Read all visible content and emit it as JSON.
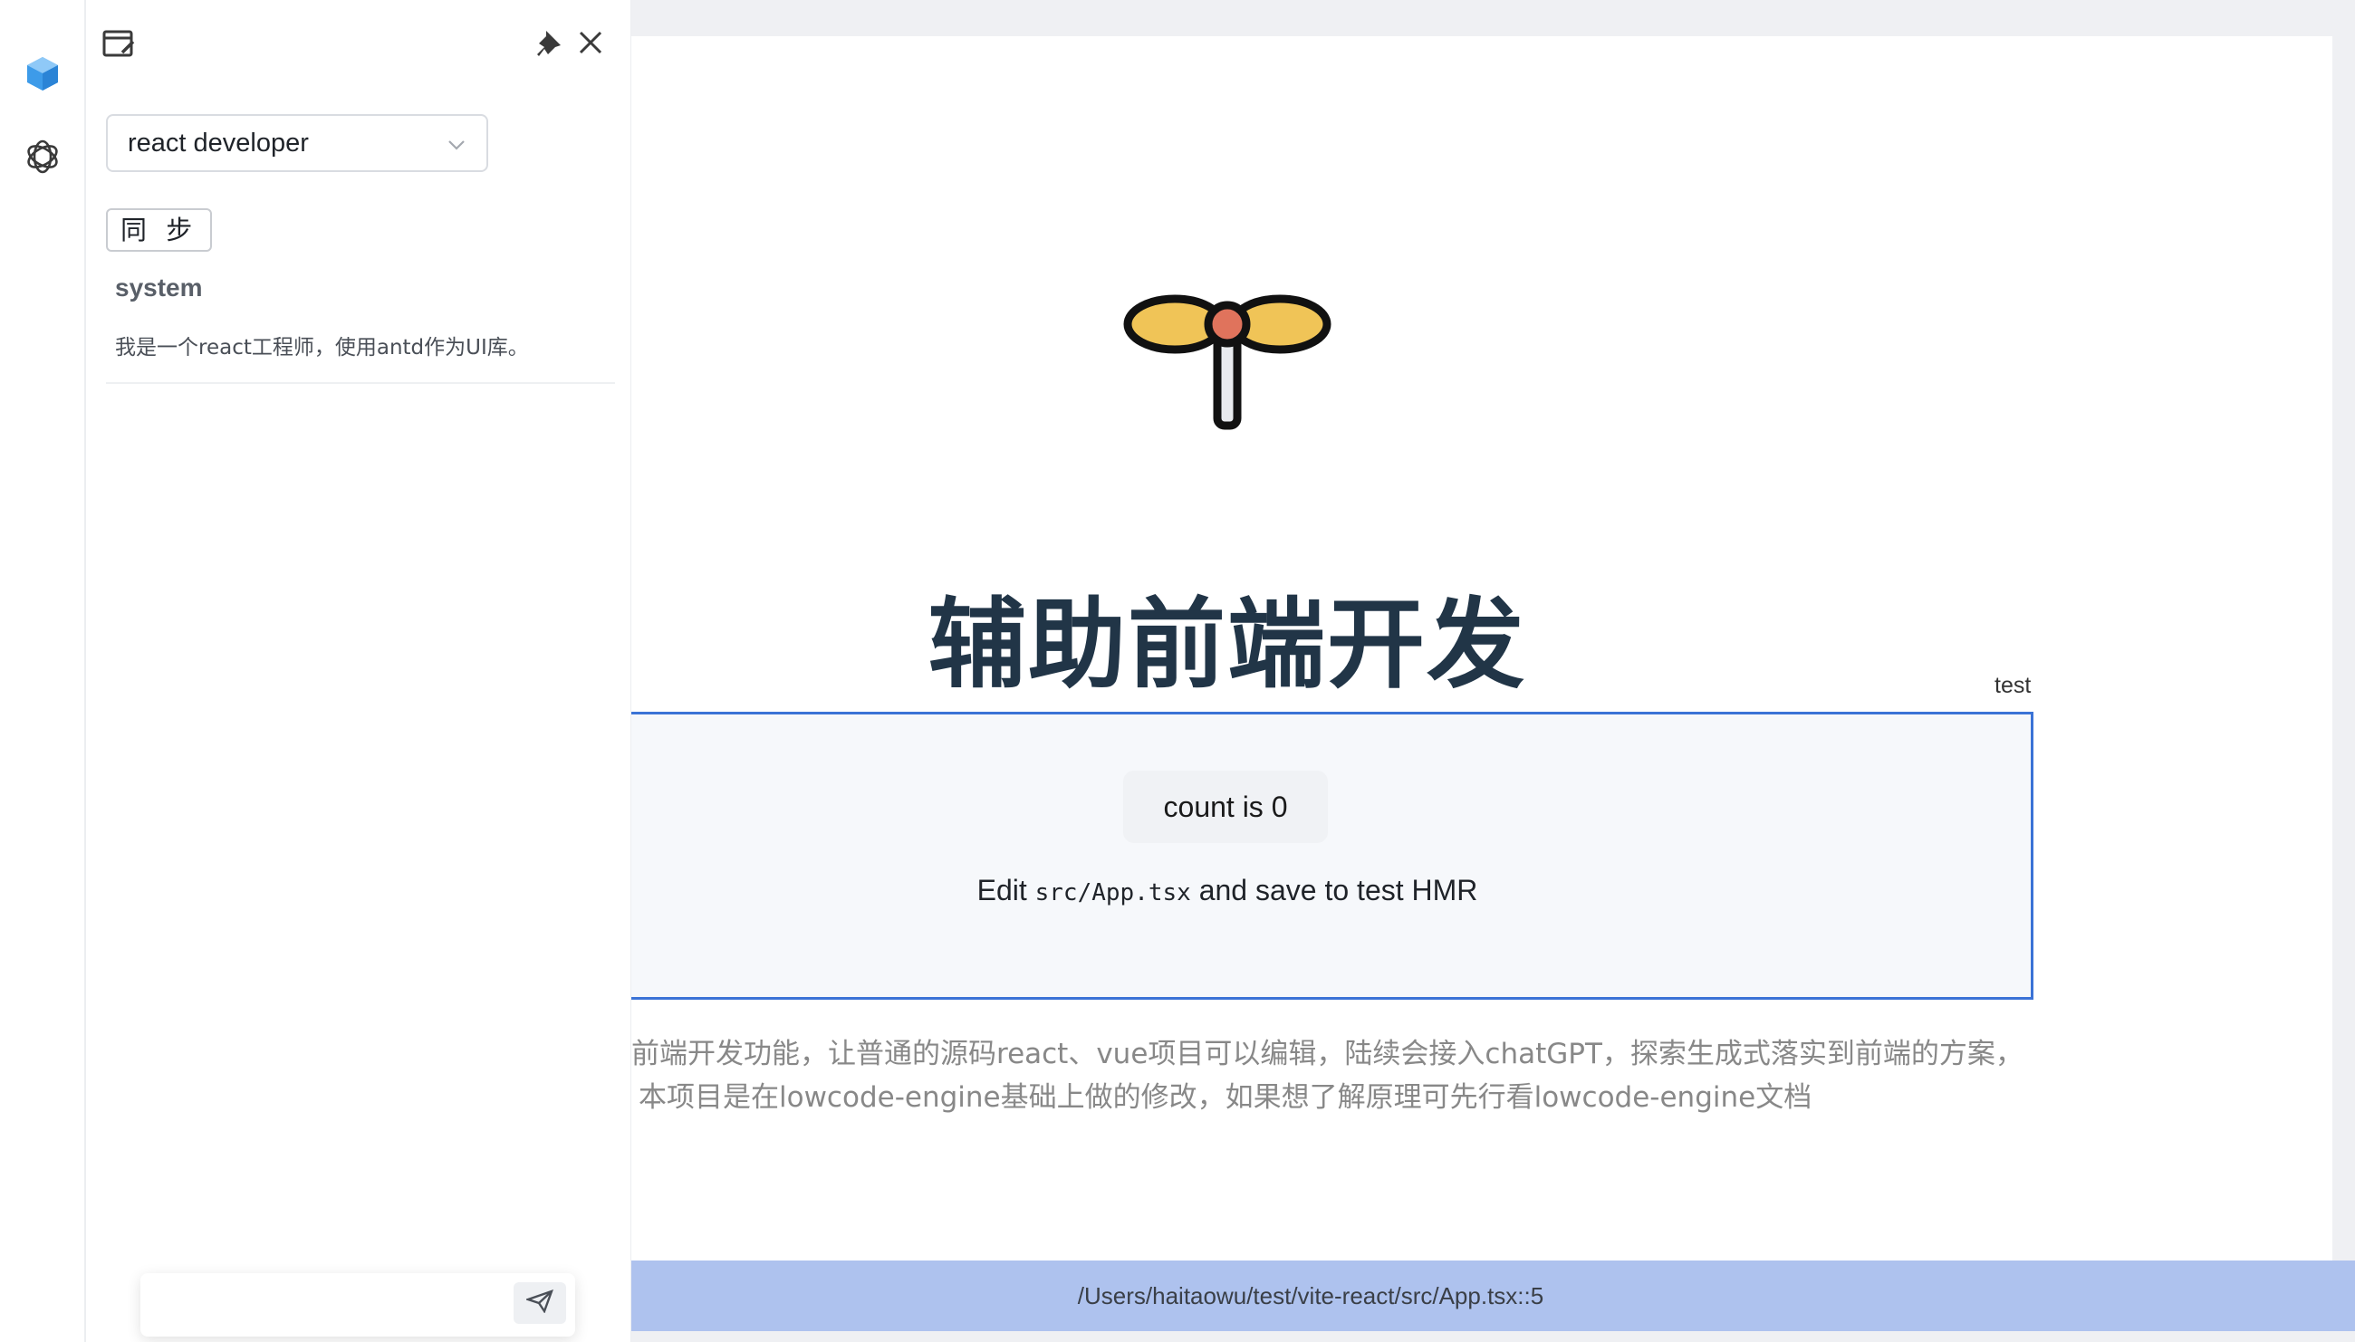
{
  "rail": {
    "items": [
      {
        "icon": "box-icon",
        "color": "#3d9be9"
      },
      {
        "icon": "openai-icon",
        "color": "#3a3a3a"
      }
    ]
  },
  "panel": {
    "icons": [
      "new-chat-icon",
      "pin-icon",
      "close-icon"
    ],
    "role_select": {
      "value": "react developer"
    },
    "sync_label": "同 步",
    "messages": [
      {
        "role": "system",
        "content": "我是一个react工程师，使用antd作为UI库。"
      }
    ]
  },
  "main": {
    "hero_title": "辅助前端开发",
    "selection_label": "test",
    "count_button": "count is 0",
    "hmr": {
      "prefix": "Edit ",
      "code": "src/App.tsx",
      "suffix": " and save to test HMR"
    },
    "description": [
      "前端开发功能，让普通的源码react、vue项目可以编辑，陆续会接入chatGPT，探索生成式落实到前端的方案，",
      "本项目是在lowcode-engine基础上做的修改，如果想了解原理可先行看lowcode-engine文档"
    ],
    "status_path": "/Users/haitaowu/test/vite-react/src/App.tsx::5"
  },
  "colors": {
    "accent": "#3b73d6",
    "title": "#213547",
    "statusbar": "#aec2ee",
    "logo_wing": "#f0c457",
    "logo_center": "#e0735c"
  }
}
